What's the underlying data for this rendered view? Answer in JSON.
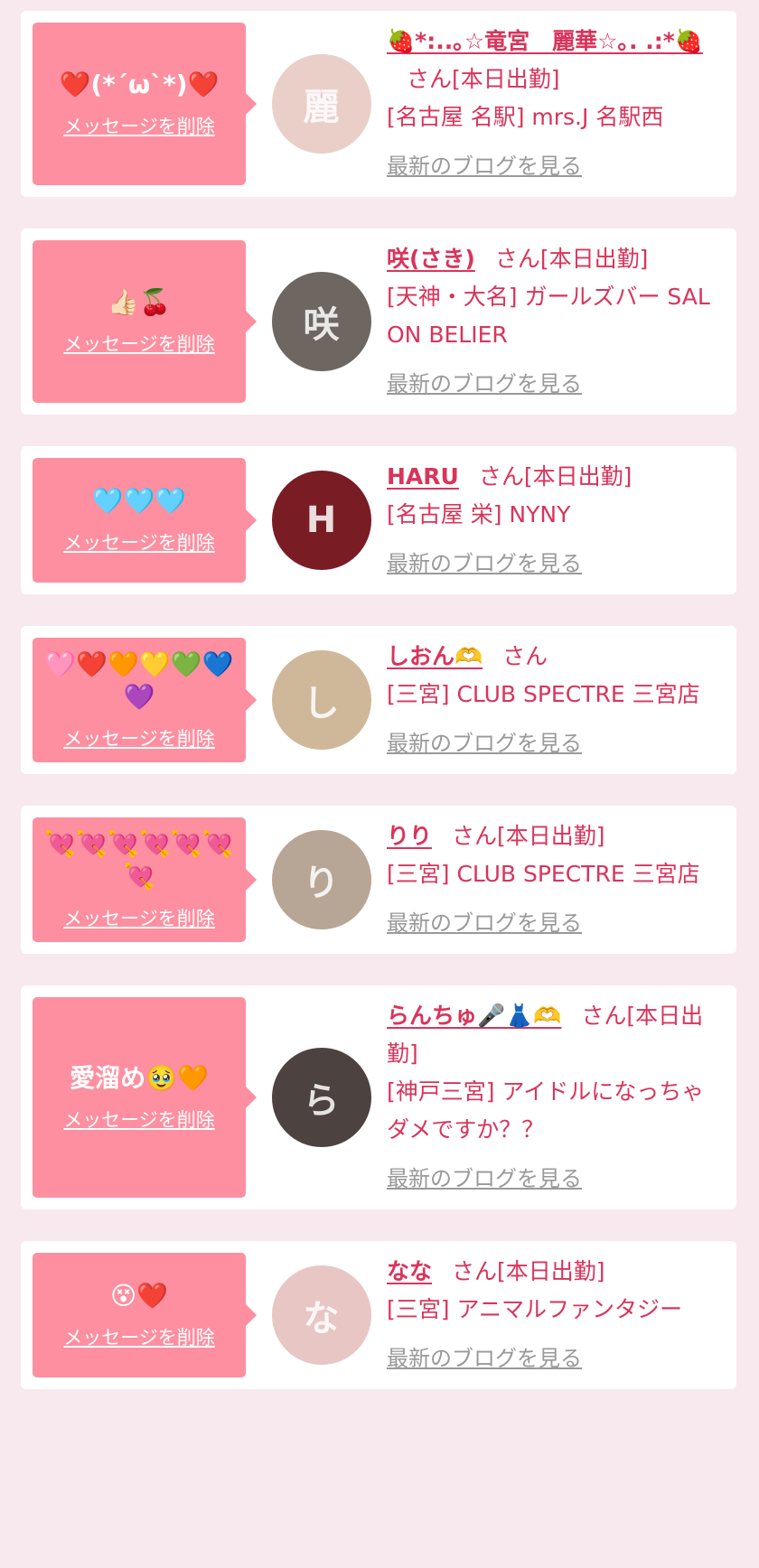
{
  "delete_label": "メッセージを削除",
  "blog_label": "最新のブログを見る",
  "san_label": "さん",
  "colors": {
    "bubble": "#fd8fa0",
    "accent": "#d9345b",
    "muted": "#999999",
    "background": "#f8e9ee",
    "card": "#ffffff"
  },
  "cards": [
    {
      "message": "❤️(*´ω`*)❤️",
      "name": "🍓*:..｡☆竜宮　麗華☆｡. .:*🍓",
      "status": "[本日出勤]",
      "shop": "[名古屋 名駅] mrs.J 名駅西",
      "avatar_color": "#e9cfc8",
      "avatar_initial": "麗"
    },
    {
      "message": "👍🏻🍒",
      "name": "咲(さき)",
      "status": "[本日出勤]",
      "shop": "[天神・大名] ガールズバー SALON BELIER",
      "avatar_color": "#6e6661",
      "avatar_initial": "咲"
    },
    {
      "message": "🩵🩵🩵",
      "name": "HARU",
      "status": "[本日出勤]",
      "shop": "[名古屋 栄] NYNY",
      "avatar_color": "#7a1c24",
      "avatar_initial": "H"
    },
    {
      "message": "🩷❤️🧡💛💚💙💜",
      "name": "しおん🫶",
      "status": "",
      "shop": "[三宮] CLUB SPECTRE 三宮店",
      "avatar_color": "#cfb79a",
      "avatar_initial": "し"
    },
    {
      "message": "💘💘💘💘💘💘💘",
      "name": "りり",
      "status": "[本日出勤]",
      "shop": "[三宮] CLUB SPECTRE 三宮店",
      "avatar_color": "#b7a595",
      "avatar_initial": "り"
    },
    {
      "message": "愛溜め🥹🧡",
      "name": "らんちゅ🎤👗🫶",
      "status": "[本日出勤]",
      "shop": "[神戸三宮] アイドルになっちゃダメですか？？",
      "avatar_color": "#4c423f",
      "avatar_initial": "ら"
    },
    {
      "message": "😵❤️",
      "name": "なな",
      "status": "[本日出勤]",
      "shop": "[三宮] アニマルファンタジー",
      "avatar_color": "#e7c6c3",
      "avatar_initial": "な"
    }
  ]
}
